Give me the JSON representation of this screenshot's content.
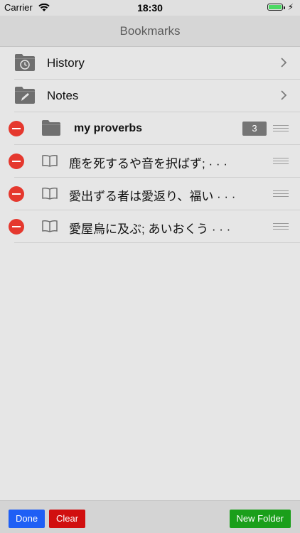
{
  "status": {
    "carrier": "Carrier",
    "time": "18:30",
    "battery_fraction": 1.0
  },
  "nav": {
    "title": "Bookmarks"
  },
  "rows": [
    {
      "label": "History",
      "icon": "history-folder-icon"
    },
    {
      "label": "Notes",
      "icon": "notes-folder-icon"
    }
  ],
  "folder": {
    "label": "my proverbs",
    "count": "3",
    "icon": "folder-icon"
  },
  "items": [
    {
      "label": "鹿を死するや音を択ばず; · · ·"
    },
    {
      "label": "愛出ずる者は愛返り、福い · · ·"
    },
    {
      "label": "愛屋烏に及ぶ; あいおくう · · ·"
    }
  ],
  "toolbar": {
    "done_label": "Done",
    "clear_label": "Clear",
    "new_folder_label": "New Folder"
  },
  "colors": {
    "delete": "#e5382e",
    "done": "#1f5ff5",
    "clear": "#d10f0f",
    "new_folder": "#1a9f1a",
    "battery": "#4cd964"
  }
}
